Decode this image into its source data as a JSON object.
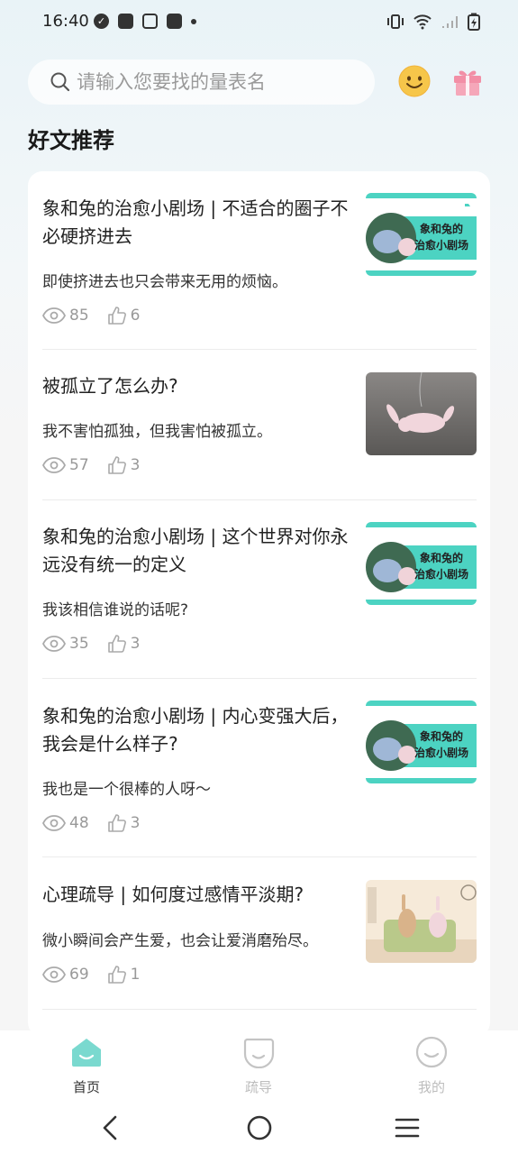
{
  "status_bar": {
    "time": "16:40"
  },
  "search": {
    "placeholder": "请输入您要找的量表名"
  },
  "section": {
    "title": "好文推荐"
  },
  "articles": [
    {
      "title": "象和兔的治愈小剧场 | 不适合的圈子不必硬挤进去",
      "desc": "即使挤进去也只会带来无用的烦恼。",
      "views": "85",
      "likes": "6",
      "thumb_text_1": "象和兔的",
      "thumb_text_2": "治愈小剧场"
    },
    {
      "title": "被孤立了怎么办?",
      "desc": "我不害怕孤独，但我害怕被孤立。",
      "views": "57",
      "likes": "3"
    },
    {
      "title": "象和兔的治愈小剧场 | 这个世界对你永远没有统一的定义",
      "desc": "我该相信谁说的话呢?",
      "views": "35",
      "likes": "3",
      "thumb_text_1": "象和兔的",
      "thumb_text_2": "治愈小剧场"
    },
    {
      "title": "象和兔的治愈小剧场 | 内心变强大后，我会是什么样子?",
      "desc": "我也是一个很棒的人呀～",
      "views": "48",
      "likes": "3",
      "thumb_text_1": "象和兔的",
      "thumb_text_2": "治愈小剧场"
    },
    {
      "title": "心理疏导 | 如何度过感情平淡期?",
      "desc": "微小瞬间会产生爱，也会让爱消磨殆尽。",
      "views": "69",
      "likes": "1"
    }
  ],
  "bottom_nav": {
    "home": "首页",
    "guide": "疏导",
    "mine": "我的"
  },
  "colors": {
    "accent": "#7ad9cf",
    "thumb_teal": "#4cd3c2",
    "gift": "#f28fa6",
    "smiley": "#f6c64a",
    "inactive": "#c4c4c4"
  }
}
